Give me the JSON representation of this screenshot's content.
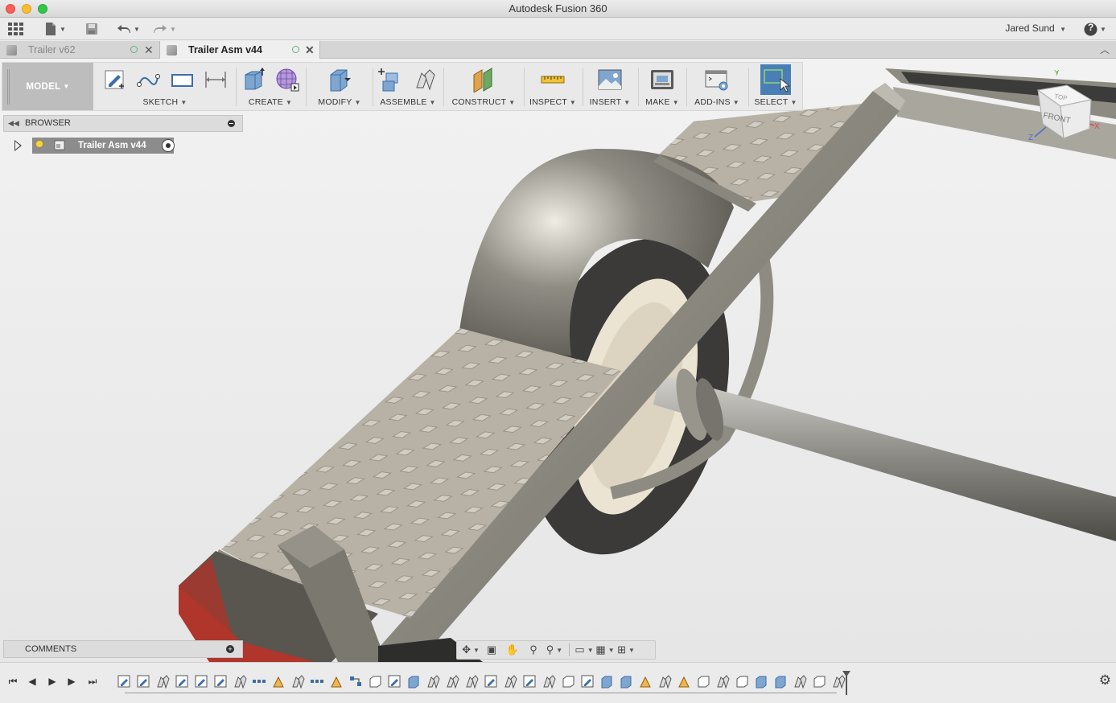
{
  "window": {
    "title": "Autodesk Fusion 360"
  },
  "appbar": {
    "user_name": "Jared Sund",
    "help": "?"
  },
  "tabs": [
    {
      "label": "Trailer v62",
      "active": false
    },
    {
      "label": "Trailer Asm v44",
      "active": true
    }
  ],
  "toolbar": {
    "workspace": "MODEL",
    "groups": [
      {
        "label": "SKETCH",
        "icons": [
          "create-sketch-icon",
          "spline-icon",
          "rectangle-icon",
          "dimension-icon"
        ]
      },
      {
        "label": "CREATE",
        "icons": [
          "extrude-icon",
          "form-icon"
        ]
      },
      {
        "label": "MODIFY",
        "icons": [
          "press-pull-icon"
        ]
      },
      {
        "label": "ASSEMBLE",
        "icons": [
          "new-component-icon",
          "joint-icon"
        ]
      },
      {
        "label": "CONSTRUCT",
        "icons": [
          "offset-plane-icon"
        ]
      },
      {
        "label": "INSPECT",
        "icons": [
          "measure-icon"
        ]
      },
      {
        "label": "INSERT",
        "icons": [
          "insert-image-icon"
        ]
      },
      {
        "label": "MAKE",
        "icons": [
          "3d-print-icon"
        ]
      },
      {
        "label": "ADD-INS",
        "icons": [
          "scripts-addins-icon"
        ]
      },
      {
        "label": "SELECT",
        "icons": [
          "select-icon"
        ]
      }
    ]
  },
  "browser": {
    "title": "BROWSER",
    "root": {
      "label": "Trailer Asm v44"
    }
  },
  "viewcube": {
    "top": "TOP",
    "front": "FRONT",
    "axis_x": "X",
    "axis_y": "Y",
    "axis_z": "Z"
  },
  "comments": {
    "title": "COMMENTS"
  },
  "timeline": {
    "feature_count": 38
  },
  "colors": {
    "accent_blue": "#4a7fb5",
    "frame_steel": "#8a8880",
    "tail_light_red": "#b0352a"
  }
}
